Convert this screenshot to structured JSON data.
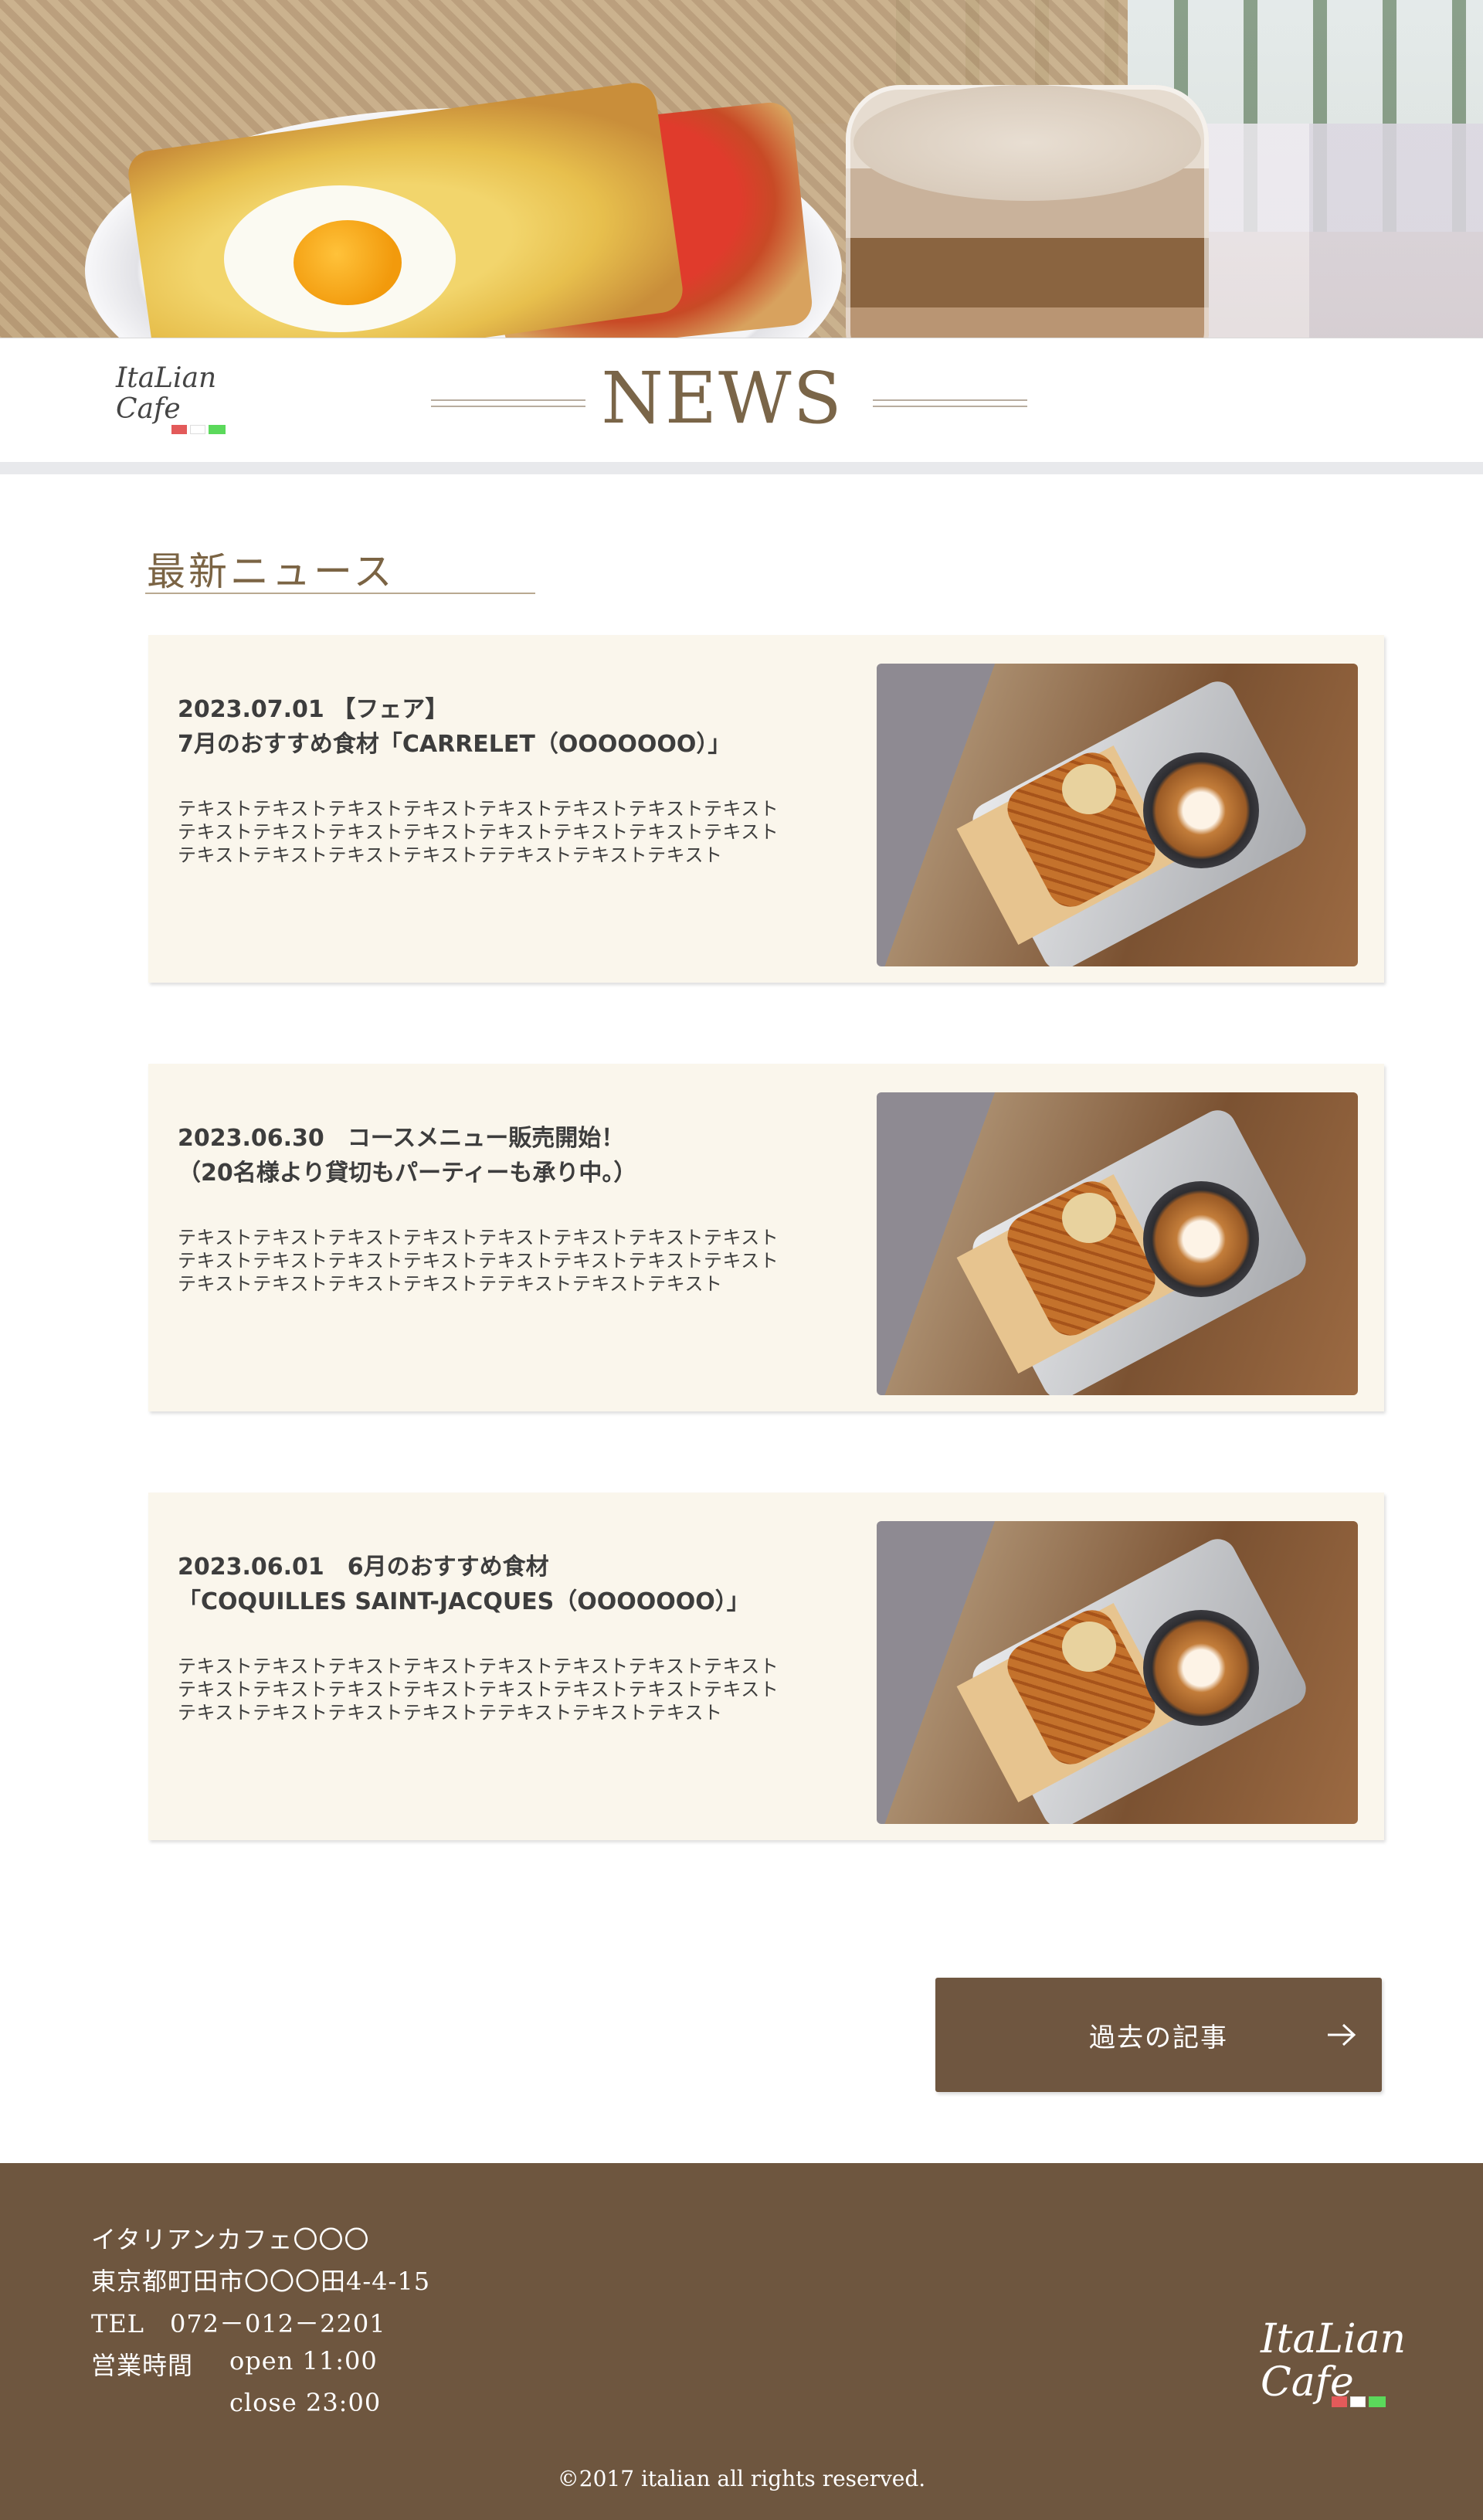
{
  "header": {
    "logo_line1": "ItaLian",
    "logo_line2": "Cafe",
    "title": "NEWS"
  },
  "section": {
    "heading": "最新ニュース"
  },
  "news": [
    {
      "headline_line1": "2023.07.01 【フェア】",
      "headline_line2": "7月のおすすめ食材「CARRELET（OOOOOOO）」",
      "body_lines": [
        "テキストテキストテキストテキストテキストテキストテキストテキスト",
        "テキストテキストテキストテキストテキストテキストテキストテキスト",
        "テキストテキストテキストテキストテテキストテキストテキスト"
      ]
    },
    {
      "headline_line1": "2023.06.30　コースメニュー販売開始！",
      "headline_line2": "（20名様より貸切もパーティーも承り中。）",
      "body_lines": [
        "テキストテキストテキストテキストテキストテキストテキストテキスト",
        "テキストテキストテキストテキストテキストテキストテキストテキスト",
        "テキストテキストテキストテキストテテキストテキストテキスト"
      ]
    },
    {
      "headline_line1": "2023.06.01　6月のおすすめ食材",
      "headline_line2": "「COQUILLES SAINT-JACQUES（OOOOOOO）」",
      "body_lines": [
        "テキストテキストテキストテキストテキストテキストテキストテキスト",
        "テキストテキストテキストテキストテキストテキストテキストテキスト",
        "テキストテキストテキストテキストテテキストテキストテキスト"
      ]
    }
  ],
  "archive_button": {
    "label": "過去の記事",
    "icon": "arrow-right-icon"
  },
  "footer": {
    "name": "イタリアンカフェ〇〇〇",
    "address": "東京都町田市〇〇〇田4-4-15",
    "tel": "TEL　072－012－2201",
    "hours_label": "営業時間",
    "open": "open 11:00",
    "close": "close 23:00",
    "copyright": "©2017 italian all rights reserved.",
    "logo_line1": "ItaLian",
    "logo_line2": "Cafe"
  },
  "colors": {
    "brand_brown": "#6e563f",
    "title_brown": "#7a6548",
    "card_bg": "#faf6ec"
  }
}
